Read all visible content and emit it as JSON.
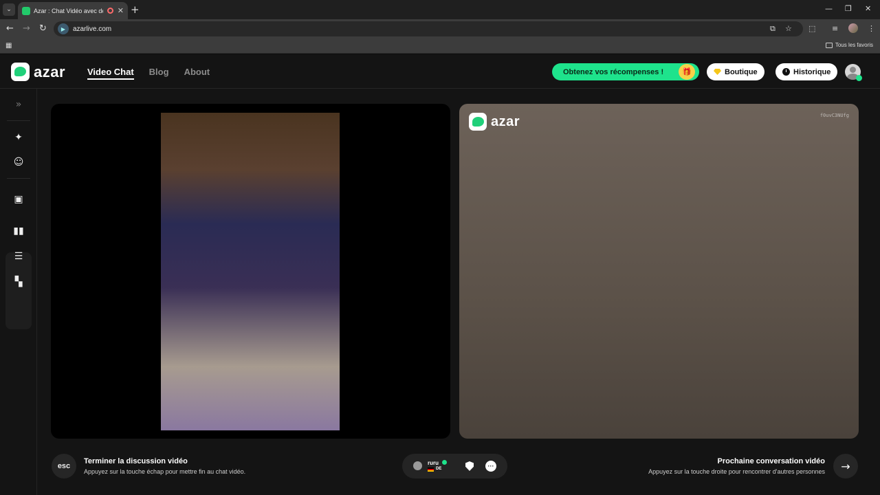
{
  "browser": {
    "tab_title": "Azar : Chat Vidéo avec de n",
    "url": "azarlive.com",
    "bookmarks_all": "Tous les favoris"
  },
  "header": {
    "logo": "azar",
    "nav": [
      "Video Chat",
      "Blog",
      "About"
    ],
    "rewards_label": "Obtenez vos récompenses !",
    "shop_label": "Boutique",
    "history_label": "Historique"
  },
  "video": {
    "right_logo": "azar",
    "session_code": "f0uvC3NUfg"
  },
  "footer": {
    "esc_key": "esc",
    "end_title": "Terminer la discussion vidéo",
    "end_sub": "Appuyez sur la touche échap pour mettre fin au chat vidéo.",
    "peer_name": "ruru",
    "peer_country": "DE",
    "next_title": "Prochaine conversation vidéo",
    "next_sub": "Appuyez sur la touche droite pour rencontrer d'autres personnes"
  },
  "colors": {
    "accent": "#1ee38c",
    "background": "#141414"
  }
}
